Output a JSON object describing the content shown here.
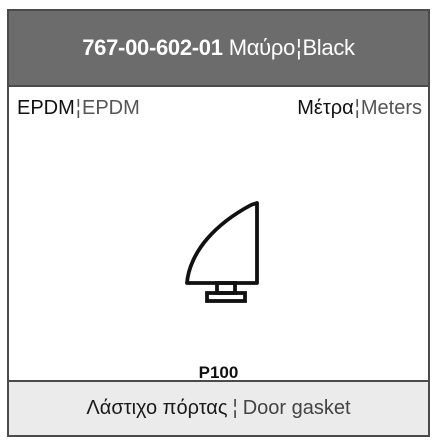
{
  "header": {
    "code": "767-00-602-01",
    "name_gr": "Μαύρο",
    "separator": "¦",
    "name_en": "Black"
  },
  "meta": {
    "material_gr": "EPDM",
    "material_sep": "¦",
    "material_en": "EPDM",
    "unit_gr": "Μέτρα",
    "unit_sep": "¦",
    "unit_en": "Meters"
  },
  "profile": {
    "code": "P100",
    "icon": "door-gasket-profile-icon"
  },
  "footer": {
    "title_gr": "Λάστιχο πόρτας",
    "separator": "¦",
    "title_en": "Door gasket"
  },
  "colors": {
    "header_bg": "#6c6c6c",
    "border": "#4b4b4b",
    "footer_bg": "#ebebeb"
  }
}
